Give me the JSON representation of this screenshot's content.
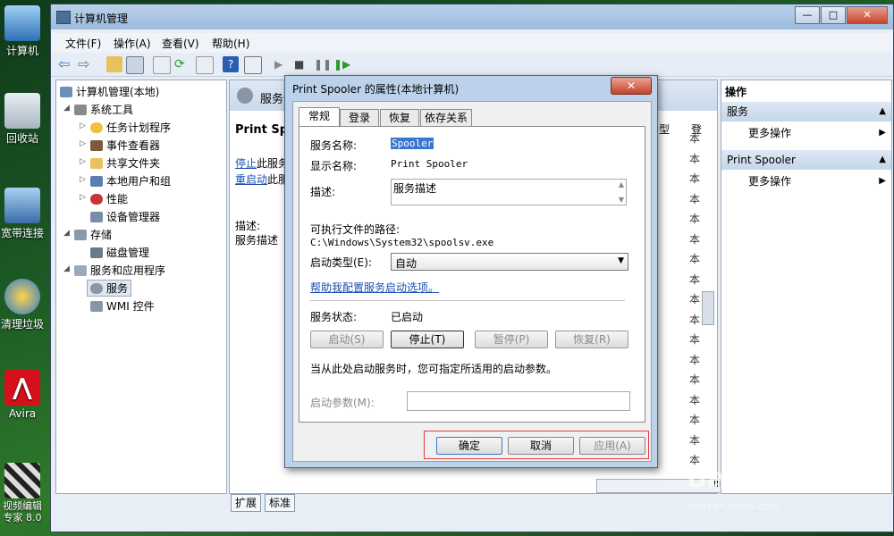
{
  "desktop": {
    "icons": [
      {
        "label": "计算机"
      },
      {
        "label": "回收站"
      },
      {
        "label": "宽带连接"
      },
      {
        "label": "清理垃圾"
      },
      {
        "label": "Avira"
      },
      {
        "label": "视频编辑专家 8.0"
      }
    ]
  },
  "window": {
    "title": "计算机管理",
    "controls": {
      "min": "—",
      "max": "□",
      "close": "✕"
    },
    "menu": [
      "文件(F)",
      "操作(A)",
      "查看(V)",
      "帮助(H)"
    ]
  },
  "tree": {
    "root": "计算机管理(本地)",
    "items": [
      {
        "label": "系统工具"
      },
      {
        "label": "任务计划程序"
      },
      {
        "label": "事件查看器"
      },
      {
        "label": "共享文件夹"
      },
      {
        "label": "本地用户和组"
      },
      {
        "label": "性能"
      },
      {
        "label": "设备管理器"
      },
      {
        "label": "存储"
      },
      {
        "label": "磁盘管理"
      },
      {
        "label": "服务和应用程序"
      },
      {
        "label": "服务"
      },
      {
        "label": "WMI 控件"
      }
    ]
  },
  "middle": {
    "header": "服务",
    "service_name": "Print Spoo",
    "stop_link": "停止",
    "stop_rest": "此服务",
    "restart_link": "重启动",
    "restart_rest": "此服",
    "desc_label": "描述:",
    "desc_value": "服务描述",
    "col_header_1": "型",
    "col_header_2": "登",
    "col_cells": [
      "本",
      "本",
      "本",
      "本",
      "本",
      "本",
      "本",
      "本",
      "本",
      "本",
      "本",
      "本",
      "本",
      "本",
      "本",
      "本",
      "本"
    ],
    "hscroll_grip": "III",
    "bottom_tabs": [
      "扩展",
      "标准"
    ]
  },
  "actions": {
    "header": "操作",
    "groups": [
      {
        "title": "服务",
        "item": "更多操作"
      },
      {
        "title": "Print Spooler",
        "item": "更多操作"
      }
    ]
  },
  "dialog": {
    "title": "Print Spooler 的属性(本地计算机)",
    "close": "✕",
    "tabs": [
      "常规",
      "登录",
      "恢复",
      "依存关系"
    ],
    "service_name_label": "服务名称:",
    "service_name_value": "Spooler",
    "display_name_label": "显示名称:",
    "display_name_value": "Print Spooler",
    "description_label": "描述:",
    "description_value": "服务描述",
    "exe_path_label": "可执行文件的路径:",
    "exe_path_value": "C:\\Windows\\System32\\spoolsv.exe",
    "startup_type_label": "启动类型(E):",
    "startup_type_value": "自动",
    "help_link": "帮助我配置服务启动选项。",
    "status_label": "服务状态:",
    "status_value": "已启动",
    "buttons": {
      "start": "启动(S)",
      "stop": "停止(T)",
      "pause": "暂停(P)",
      "resume": "恢复(R)"
    },
    "hint": "当从此处启动服务时，您可指定所适用的启动参数。",
    "param_label": "启动参数(M):",
    "param_value": "",
    "ok": "确定",
    "cancel": "取消",
    "apply": "应用(A)"
  },
  "watermark": {
    "brand": "Bai 经验",
    "url": "jingyan.baidu.com"
  }
}
